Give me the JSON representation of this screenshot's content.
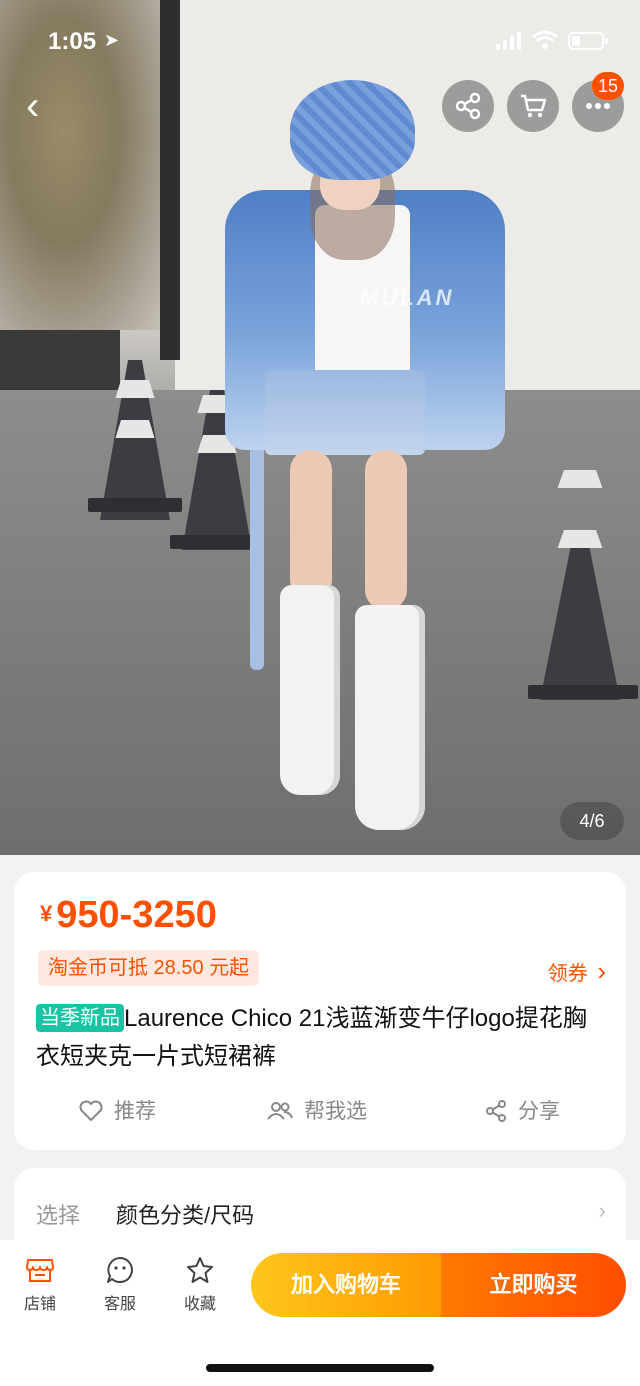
{
  "status_bar": {
    "time": "1:05",
    "location_glyph": "➤"
  },
  "nav": {
    "back_glyph": "‹",
    "more_badge": "15"
  },
  "gallery": {
    "counter": "4/6",
    "watermark": "MULAN"
  },
  "product": {
    "price_symbol": "¥",
    "price_range": "950-3250",
    "coin_offer": "淘金币可抵 28.50 元起",
    "coupon_label": "领券",
    "coupon_chevron": "›",
    "new_tag": "当季新品",
    "title": "Laurence  Chico 21浅蓝渐变牛仔logo提花胸衣短夹克一片式短裙裤"
  },
  "actions": {
    "recommend": "推荐",
    "help_choose": "帮我选",
    "share": "分享"
  },
  "selection": {
    "label": "选择",
    "value": "颜色分类/尺码",
    "chevron": "›"
  },
  "bottom_bar": {
    "shop": "店铺",
    "service": "客服",
    "favorite": "收藏",
    "add_to_cart": "加入购物车",
    "buy_now": "立即购买"
  },
  "colors": {
    "accent": "#ff5000",
    "cart_gradient": [
      "#ffc61a",
      "#ff9a02"
    ],
    "buy_gradient": [
      "#ff7a00",
      "#ff4d00"
    ],
    "new_tag": "#19c3a4"
  }
}
